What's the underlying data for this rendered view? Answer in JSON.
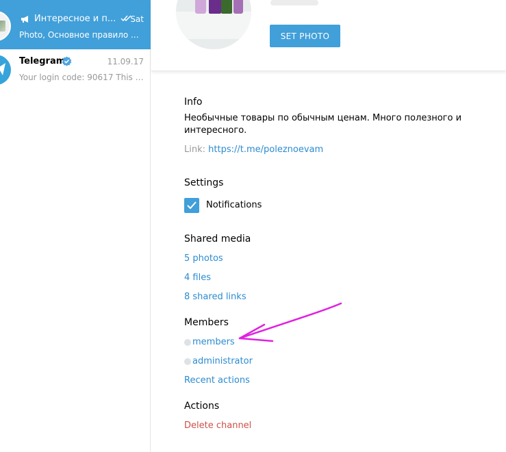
{
  "sidebar": {
    "chats": [
      {
        "title": "Интересное и п...",
        "time": "Sat",
        "preview": "Photo, Основное правило ..."
      },
      {
        "title": "Telegram",
        "time": "11.09.17",
        "preview": "Your login code: 90617  This c..."
      }
    ]
  },
  "profile": {
    "set_photo_label": "SET PHOTO"
  },
  "info": {
    "heading": "Info",
    "description": "Необычные товары по обычным ценам. Много полезного и интересного.",
    "link_label": "Link:",
    "link_url": "https://t.me/poleznoevam"
  },
  "settings": {
    "heading": "Settings",
    "notifications_label": "Notifications",
    "notifications_checked": true
  },
  "shared_media": {
    "heading": "Shared media",
    "items": [
      "5 photos",
      "4 files",
      "8 shared links"
    ]
  },
  "members": {
    "heading": "Members",
    "members_label": "members",
    "administrator_label": "administrator",
    "recent_actions_label": "Recent actions"
  },
  "actions": {
    "heading": "Actions",
    "delete_label": "Delete channel"
  },
  "colors": {
    "accent": "#419fd9",
    "link": "#2b8bd1",
    "danger": "#cc5049",
    "annotation": "#e020e0"
  }
}
